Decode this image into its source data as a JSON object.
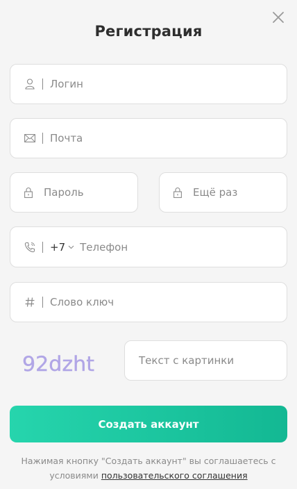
{
  "modal": {
    "title": "Регистрация"
  },
  "fields": {
    "login": {
      "placeholder": "Логин",
      "icon": "user-icon"
    },
    "email": {
      "placeholder": "Почта",
      "icon": "mail-icon"
    },
    "password": {
      "placeholder": "Пароль",
      "icon": "lock-icon"
    },
    "password_repeat": {
      "placeholder": "Ещё раз",
      "icon": "lock-icon"
    },
    "phone": {
      "placeholder": "Телефон",
      "icon": "phone-icon",
      "country_code": "+7"
    },
    "keyword": {
      "placeholder": "Слово ключ",
      "icon": "hash-icon"
    },
    "captcha_input": {
      "placeholder": "Текст с картинки"
    }
  },
  "captcha": {
    "text": "92dzht",
    "color": "#b1a6e6"
  },
  "submit_label": "Создать аккаунт",
  "agreement": {
    "text": "Нажимая кнопку \"Создать аккаунт\" вы соглашаетесь с условиями",
    "link": "пользовательского соглашения"
  },
  "colors": {
    "accent_start": "#26d5ad",
    "accent_end": "#13b893",
    "background": "#f5f5f5"
  }
}
